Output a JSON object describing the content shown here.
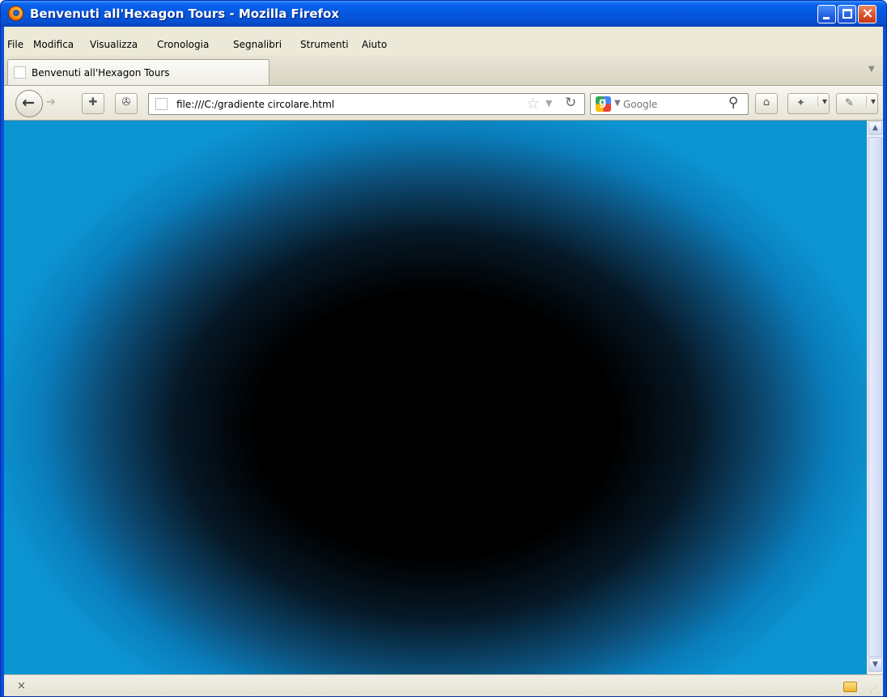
{
  "window": {
    "title": "Benvenuti all'Hexagon Tours - Mozilla Firefox"
  },
  "menubar": {
    "items": [
      "File",
      "Modifica",
      "Visualizza",
      "Cronologia",
      "Segnalibri",
      "Strumenti",
      "Aiuto"
    ]
  },
  "tabs": [
    {
      "title": "Benvenuti all'Hexagon Tours"
    }
  ],
  "navbar": {
    "url": "file:///C:/gradiente circolare.html",
    "search_placeholder": "Google"
  },
  "content": {
    "gradient_center_color": "#000000",
    "gradient_edge_color": "#0c95d3"
  },
  "statusbar": {
    "close_label": "×"
  }
}
